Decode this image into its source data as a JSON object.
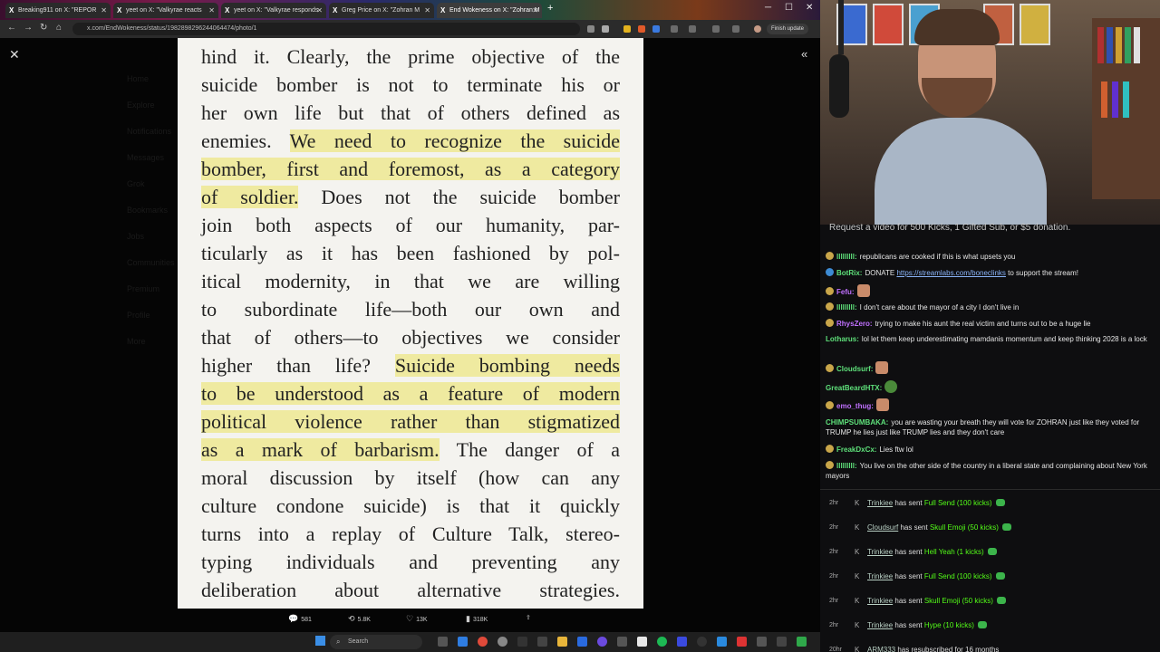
{
  "browser": {
    "tabs": [
      {
        "label": "Breaking911 on X: \"REPOR"
      },
      {
        "label": "yeet on X: \"Valkyrae reacts"
      },
      {
        "label": "yeet on X: \"Valkyrae responds"
      },
      {
        "label": "Greg Price on X: \"Zohran M"
      },
      {
        "label": "End Wokeness on X: \"Zohran M"
      }
    ],
    "url": "x.com/EndWokeness/status/1982898296244064474/photo/1",
    "finish_update": "Finish update"
  },
  "viewer": {
    "ghost_sidebar": [
      "Home",
      "Explore",
      "Notifications",
      "Messages",
      "Grok",
      "Bookmarks",
      "Jobs",
      "Communities",
      "Premium",
      "Profile",
      "More"
    ],
    "page_lines": [
      {
        "segments": [
          {
            "t": "hind it. Clearly, the prime objective of the",
            "h": false
          }
        ]
      },
      {
        "segments": [
          {
            "t": "suicide bomber is not to terminate his or",
            "h": false
          }
        ]
      },
      {
        "segments": [
          {
            "t": "her own life but that of others defined as",
            "h": false
          }
        ]
      },
      {
        "segments": [
          {
            "t": "enemies. ",
            "h": false
          },
          {
            "t": "We need to recognize the suicide",
            "h": true
          }
        ]
      },
      {
        "segments": [
          {
            "t": "bomber, first and foremost, as a category",
            "h": true
          }
        ]
      },
      {
        "segments": [
          {
            "t": "of soldier.",
            "h": true
          },
          {
            "t": " Does not the suicide bomber",
            "h": false
          }
        ]
      },
      {
        "segments": [
          {
            "t": "join both aspects of our humanity, par-",
            "h": false
          }
        ]
      },
      {
        "segments": [
          {
            "t": "ticularly as it has been fashioned by pol-",
            "h": false
          }
        ]
      },
      {
        "segments": [
          {
            "t": "itical modernity, in that we are willing",
            "h": false
          }
        ]
      },
      {
        "segments": [
          {
            "t": "to subordinate life—both our own and",
            "h": false
          }
        ]
      },
      {
        "segments": [
          {
            "t": "that of others—to objectives we consider",
            "h": false
          }
        ]
      },
      {
        "segments": [
          {
            "t": "higher than life? ",
            "h": false
          },
          {
            "t": "Suicide bombing needs",
            "h": true
          }
        ]
      },
      {
        "segments": [
          {
            "t": "to be understood as a feature of modern",
            "h": true
          }
        ]
      },
      {
        "segments": [
          {
            "t": "political violence rather than stigmatized",
            "h": true
          }
        ]
      },
      {
        "segments": [
          {
            "t": "as a mark of barbarism.",
            "h": true
          },
          {
            "t": " The danger of a",
            "h": false
          }
        ]
      },
      {
        "segments": [
          {
            "t": "moral discussion by itself (how can any",
            "h": false
          }
        ]
      },
      {
        "segments": [
          {
            "t": "culture condone suicide) is that it quickly",
            "h": false
          }
        ]
      },
      {
        "segments": [
          {
            "t": "turns into a replay of Culture Talk, stereo-",
            "h": false
          }
        ]
      },
      {
        "segments": [
          {
            "t": "typing individuals and preventing any",
            "h": false
          }
        ]
      },
      {
        "segments": [
          {
            "t": "deliberation about alternative strategies.",
            "h": false
          }
        ]
      }
    ],
    "actions": {
      "replies": "581",
      "reposts": "5.8K",
      "likes": "13K",
      "views": "318K"
    }
  },
  "taskbar": {
    "search": "Search"
  },
  "chat": {
    "banner": "Request a video for 500 Kicks, 1 Gifted Sub, or $5 donation.",
    "messages": [
      {
        "user": "lllllllll:",
        "color": "#5ee07a",
        "text": "republicans are cooked if this is what upsets you"
      },
      {
        "user": "BotRix:",
        "color": "#5ee07a",
        "text": "DONATE",
        "link": "https://streamlabs.com/boneclinks",
        "after": "to support the stream!"
      },
      {
        "user": "Fefu:",
        "color": "#c070ff",
        "text": ""
      },
      {
        "user": "lllllllll:",
        "color": "#5ee07a",
        "text": "I don't care about the mayor of a city I don't live in"
      },
      {
        "user": "RhysZero:",
        "color": "#c070ff",
        "text": "trying to make his aunt the real victim and turns out to be a huge lie"
      },
      {
        "user": "Lotharus:",
        "color": "#5ee07a",
        "text": "lol let them keep underestimating mamdanis momentum and keep thinking 2028 is a lock"
      },
      {
        "user": "Cloudsurf:",
        "color": "#5ee07a",
        "text": ""
      },
      {
        "user": "GreatBeardHTX:",
        "color": "#5ee07a",
        "text": ""
      },
      {
        "user": "emo_thug:",
        "color": "#c070ff",
        "text": ""
      },
      {
        "user": "CHIMPSUMBAKA:",
        "color": "#5ee07a",
        "text": "you are wasting your breath they will vote for ZOHRAN just like they voted for TRUMP he lies just like TRUMP lies and they don't care"
      },
      {
        "user": "FreakDxCx:",
        "color": "#5ee07a",
        "text": "Lies ftw lol"
      },
      {
        "user": "lllllllll:",
        "color": "#5ee07a",
        "text": "You live on the other side of the country in a liberal state and complaining about New York mayors"
      }
    ],
    "events": [
      {
        "time": "2hr",
        "name": "Trinkiee",
        "mid": "has sent",
        "item": "Full Send (100 kicks)"
      },
      {
        "time": "2hr",
        "name": "Cloudsurf",
        "mid": "has sent",
        "item": "Skull Emoji (50 kicks)"
      },
      {
        "time": "2hr",
        "name": "Trinkiee",
        "mid": "has sent",
        "item": "Hell Yeah (1 kicks)"
      },
      {
        "time": "2hr",
        "name": "Trinkiee",
        "mid": "has sent",
        "item": "Full Send (100 kicks)"
      },
      {
        "time": "2hr",
        "name": "Trinkiee",
        "mid": "has sent",
        "item": "Skull Emoji (50 kicks)"
      },
      {
        "time": "2hr",
        "name": "Trinkiee",
        "mid": "has sent",
        "item": "Hype (10 kicks)"
      },
      {
        "time": "20hr",
        "name": "ARM333",
        "mid": "has resubscribed for 16 months",
        "item": ""
      }
    ]
  }
}
